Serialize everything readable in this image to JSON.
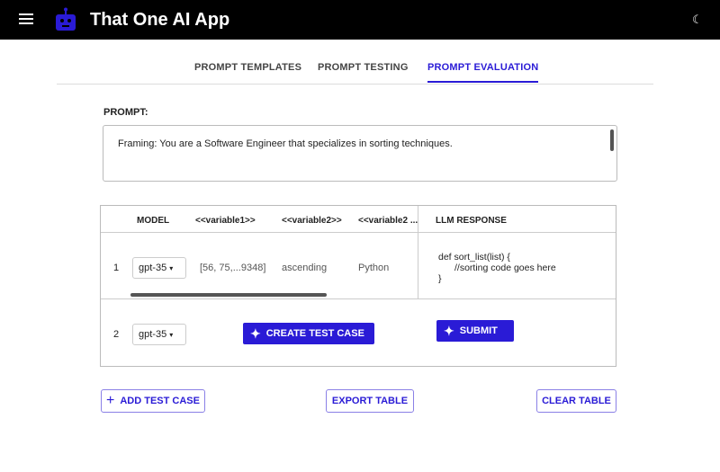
{
  "app": {
    "title": "That One AI App"
  },
  "tabs": [
    {
      "label": "PROMPT TEMPLATES"
    },
    {
      "label": "PROMPT TESTING"
    },
    {
      "label": "PROMPT EVALUATION"
    }
  ],
  "prompt": {
    "label": "PROMPT:",
    "value": "Framing: You are a Software Engineer that specializes in sorting techniques."
  },
  "table": {
    "headers": [
      "MODEL",
      "<<variable1>>",
      "<<variable2>>",
      "<<variable2 ...",
      "LLM RESPONSE"
    ],
    "rows": [
      {
        "num": "1",
        "model": "gpt-35",
        "var1": "[56, 75,...9348]",
        "var2": "ascending",
        "var3": "Python",
        "response": [
          "def sort_list(list) {",
          "//sorting code goes here",
          "}"
        ]
      },
      {
        "num": "2",
        "model": "gpt-35",
        "create": "CREATE TEST CASE",
        "submit": "SUBMIT"
      }
    ]
  },
  "actions": {
    "add": "ADD TEST CASE",
    "export": "EXPORT TABLE",
    "clear": "CLEAR TABLE"
  },
  "colors": {
    "accent": "#2a1bd6"
  }
}
